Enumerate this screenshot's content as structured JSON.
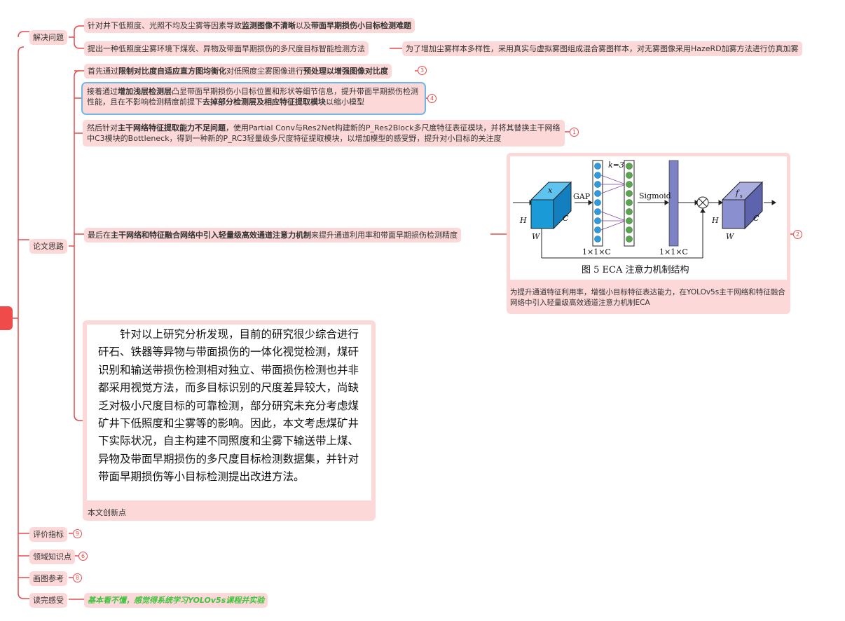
{
  "colors": {
    "line": "#e84a4a",
    "node_bg": "#fcd8d8",
    "root": "#ef4b4b",
    "highlight": "#6fb7e6",
    "green_text": "#3cc43c"
  },
  "topics": {
    "solve": {
      "label": "解决问题",
      "problem": {
        "pre": "针对井下低照度、光照不均及尘雾等因素导致",
        "b1": "监测图像不清晰",
        "mid": "以及",
        "b2": "带面早期损伤小目标检测难题"
      },
      "method": "提出一种低照度尘雾环境下煤炭、异物及带面早期损伤的多尺度目标智能检测方法",
      "method_child": "为了增加尘雾样本多样性，采用真实与虚拟雾图组成混合雾图样本，对无雾图像采用HazeRD加雾方法进行仿真加雾"
    },
    "idea": {
      "label": "论文思路",
      "step1": {
        "pre": "首先通过",
        "b1": "限制对比度自适应直方图均衡化",
        "mid": "对低照度尘雾图像进行",
        "b2": "预处理以增强图像对比度",
        "badge": "3"
      },
      "step2": {
        "pre": "接着通过",
        "b1": "增加浅层检测层",
        "mid": "凸显带面早期损伤小目标位置和形状等细节信息，提升带面早期损伤检测性能，且在不影响检测精度前提下",
        "b2": "去掉部分检测层及相应特征提取模块",
        "post": "以缩小模型",
        "badge": "4"
      },
      "step3": {
        "pre": "然后针对",
        "b1": "主干网络特征提取能力不足问题",
        "post": "，使用Partial Conv与Res2Net构建新的P_Res2Block多尺度特征表征模块，并将其替换主干网络中C3模块的Bottleneck，得到一种新的P_RC3轻量级多尺度特征提取模块，以增加模型的感受野，提升对小目标的关注度",
        "badge": "1"
      },
      "step4": {
        "pre": "最后在",
        "b1": "主干网络和特征融合网络中引入轻量级高效通道注意力机制",
        "post": "来提升通道利用率和带面早期损伤检测精度",
        "badge": "2"
      },
      "figure": {
        "caption": "图 5   ECA 注意力机制结构",
        "labels": {
          "x": "x",
          "gap": "GAP",
          "k": "k=3",
          "sigmoid": "Sigmoid",
          "h": "H",
          "w": "W",
          "c": "C",
          "vec1": "1×1×C",
          "vec2": "1×1×C",
          "fout": "f",
          "fout_sub": "s"
        },
        "note": "为提升通道特征利用率，增强小目标特征表达能力，在YOLOv5s主干网络和特征融合网络中引入轻量级高效通道注意力机制ECA"
      },
      "innovation": {
        "text": "针对以上研究分析发现，目前的研究很少综合进行矸石、铁器等异物与带面损伤的一体化视觉检测，煤矸识别和输送带损伤检测相对独立、带面损伤检测也并非都采用视觉方法，而多目标识别的尺度差异较大，尚缺乏对极小尺度目标的可靠检测，部分研究未充分考虑煤矿井下低照度和尘雾等的影响。因此，本文考虑煤矿井下实际状况，自主构建不同照度和尘雾下输送带上煤、异物及带面早期损伤的多尺度目标检测数据集，并针对带面早期损伤等小目标检测提出改进方法。",
        "label": "本文创新点"
      }
    },
    "metrics": {
      "label": "评价指标",
      "badge": "9"
    },
    "domain": {
      "label": "领域知识点",
      "badge": "6"
    },
    "drawing": {
      "label": "画图参考",
      "badge": "8"
    },
    "feeling": {
      "label": "读完感受",
      "text": "基本看不懂，感觉得系统学习YOLOv5s课程并实验"
    }
  }
}
